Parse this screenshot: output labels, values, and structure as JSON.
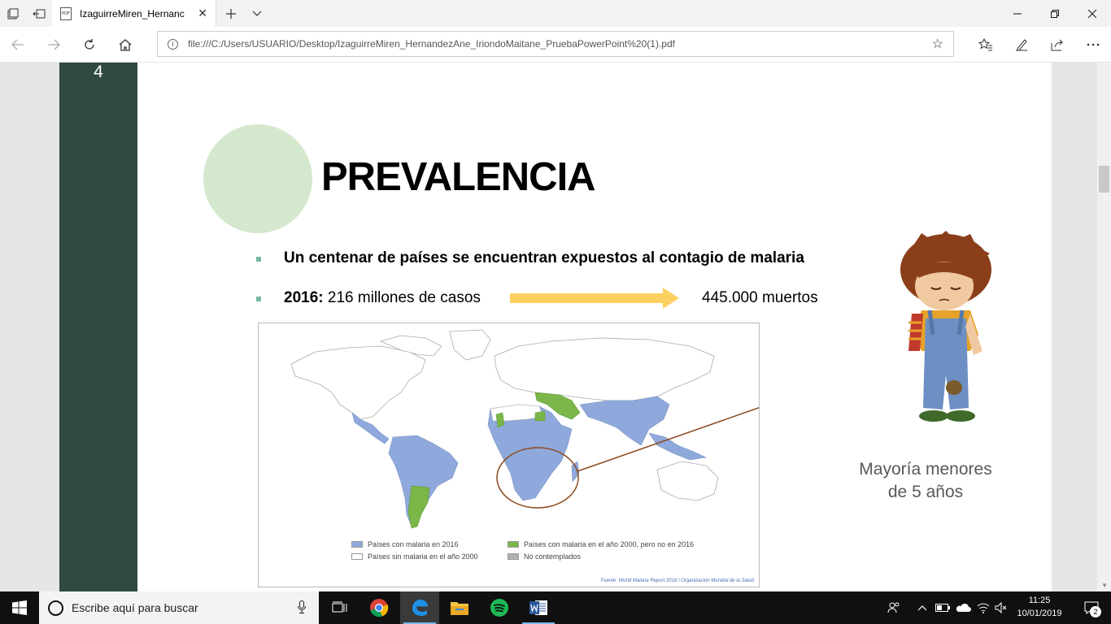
{
  "window": {
    "tab_title": "IzaguirreMiren_HernandezAne_IriondoMaitane_PruebaPowerPoint (1).pdf",
    "tab_title_visible": "IzaguirreMiren_Hernanc",
    "pdf_icon_text": "PDF"
  },
  "address_bar": {
    "url": "file:///C:/Users/USUARIO/Desktop/IzaguirreMiren_HernandezAne_IriondoMaitane_PruebaPowerPoint%20(1).pdf"
  },
  "slide": {
    "number": "4",
    "title": "PREVALENCIA",
    "bullet1": "Un centenar de países se encuentran expuestos al contagio de malaria",
    "bullet2_bold": "2016:",
    "bullet2_rest": " 216 millones de casos",
    "deaths": "445.000 muertos",
    "caption_line1": "Mayoría menores",
    "caption_line2": "de 5 años",
    "map": {
      "legend": [
        {
          "label": "Países con malaria en 2016",
          "color": "#8fa9dc"
        },
        {
          "label": "Países sin malaria en el año 2000",
          "color": "#ffffff"
        },
        {
          "label": "Países con malaria en el año 2000, pero no en 2016",
          "color": "#7ab648"
        },
        {
          "label": "No contemplados",
          "color": "#b0b0b0"
        }
      ],
      "source": "Fuente: World Malaria Report 2016 / Organización Mundial de la Salud"
    }
  },
  "taskbar": {
    "search_placeholder": "Escribe aquí para buscar",
    "time": "11:25",
    "date": "10/01/2019",
    "notification_count": "2"
  },
  "colors": {
    "slide_sidebar": "#2f4a3f",
    "title_circle": "#d4e8cd",
    "arrow": "#fdd061",
    "malaria_2016": "#8fa9dc",
    "malaria_2000_only": "#7ab648",
    "pointer_line": "#8b4a1c"
  }
}
